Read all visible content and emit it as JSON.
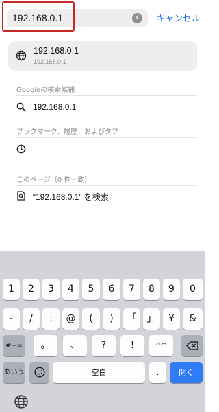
{
  "top_bar": {
    "address_value": "192.168.0.1",
    "clear_icon": "clear-circle-icon",
    "cancel_label": "キャンセル",
    "highlight_color": "#c62828",
    "accent_color": "#1a6fe0"
  },
  "top_suggestion": {
    "icon": "globe-icon",
    "title": "192.168.0.1",
    "subtitle": "192.168.0.1"
  },
  "sections": {
    "google": {
      "header": "Googleの検索候補",
      "items": [
        {
          "icon": "search-icon",
          "label": "192.168.0.1"
        }
      ]
    },
    "bookmarks": {
      "header": "ブックマーク、履歴、およびタブ",
      "items": [
        {
          "icon": "clock-icon",
          "label": ""
        }
      ]
    },
    "this_page": {
      "header": "このページ（0 件一致）",
      "items": [
        {
          "icon": "find-in-page-icon",
          "label": "“192.168.0.1” を検索"
        }
      ]
    }
  },
  "keyboard": {
    "row1": [
      "1",
      "2",
      "3",
      "4",
      "5",
      "6",
      "7",
      "8",
      "9",
      "0"
    ],
    "row2": [
      "-",
      "/",
      ":",
      "@",
      "(",
      ")",
      "「",
      "」",
      "¥",
      "&"
    ],
    "row3": [
      "#+=",
      "。",
      "、",
      "?",
      "!",
      "^^"
    ],
    "row4_left": "あいう",
    "space_label": "空白",
    "period_label": ".",
    "go_label": "開く",
    "icons": [
      "backspace-icon",
      "emoji-icon",
      "globe-icon"
    ],
    "go_color": "#2f7cf6"
  }
}
